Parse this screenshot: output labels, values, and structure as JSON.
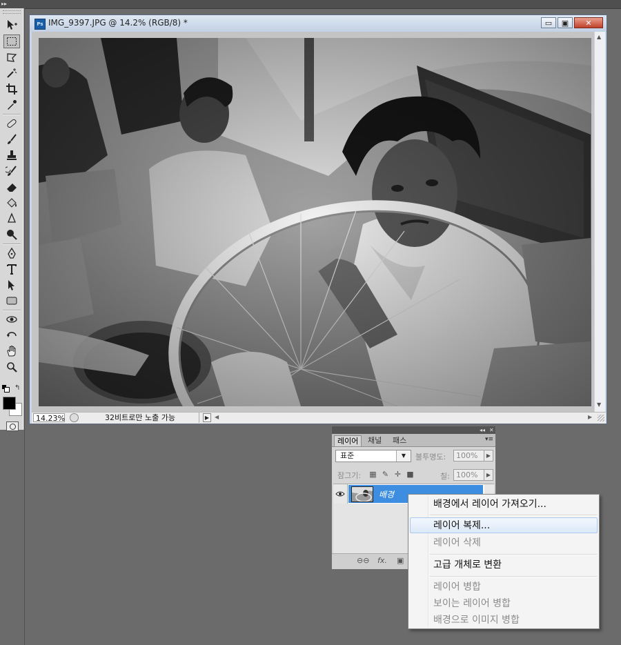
{
  "document": {
    "title": "IMG_9397.JPG @ 14.2% (RGB/8) *",
    "app_badge": "Ps",
    "zoom": "14.23%",
    "status_text": "32비트로만 노출 가능"
  },
  "window_controls": {
    "minimize_glyph": "▭",
    "maximize_glyph": "▣",
    "close_glyph": "✕"
  },
  "tools": [
    {
      "name": "move-tool-icon"
    },
    {
      "name": "marquee-tool-icon",
      "active": true
    },
    {
      "name": "lasso-tool-icon"
    },
    {
      "name": "magic-wand-tool-icon"
    },
    {
      "name": "crop-tool-icon"
    },
    {
      "name": "eyedropper-tool-icon"
    },
    {
      "name": "healing-brush-tool-icon"
    },
    {
      "name": "brush-tool-icon"
    },
    {
      "name": "clone-stamp-tool-icon"
    },
    {
      "name": "history-brush-tool-icon"
    },
    {
      "name": "eraser-tool-icon"
    },
    {
      "name": "paint-bucket-tool-icon"
    },
    {
      "name": "blur-tool-icon"
    },
    {
      "name": "dodge-tool-icon"
    },
    {
      "name": "pen-tool-icon"
    },
    {
      "name": "type-tool-icon"
    },
    {
      "name": "path-selection-tool-icon"
    },
    {
      "name": "rectangle-shape-tool-icon"
    },
    {
      "name": "3d-rotate-tool-icon"
    },
    {
      "name": "3d-orbit-tool-icon"
    },
    {
      "name": "hand-tool-icon"
    },
    {
      "name": "zoom-tool-icon"
    }
  ],
  "colors": {
    "foreground": "#000000",
    "background": "#ffffff",
    "selection_accent": "#3d8ee0",
    "close_button": "#c0412a"
  },
  "layers_panel": {
    "tabs": [
      {
        "label": "레이어",
        "active": true
      },
      {
        "label": "채널",
        "active": false
      },
      {
        "label": "패스",
        "active": false
      }
    ],
    "blend_mode": "표준",
    "opacity_label": "불투명도:",
    "opacity_value": "100%",
    "lock_label": "잠그기:",
    "fill_label": "칠:",
    "fill_value": "100%",
    "layers": [
      {
        "name": "배경",
        "visible": true,
        "selected": true
      }
    ],
    "bottom_icons": [
      "link-icon",
      "fx-icon",
      "mask-icon"
    ]
  },
  "context_menu": {
    "items": [
      {
        "label": "배경에서 레이어 가져오기...",
        "enabled": true
      },
      {
        "label": "레이어 복제...",
        "enabled": true,
        "highlighted": true
      },
      {
        "label": "레이어 삭제",
        "enabled": false
      },
      {
        "label": "고급 개체로 변환",
        "enabled": true
      },
      {
        "label": "레이어 병합",
        "enabled": false
      },
      {
        "label": "보이는 레이어 병합",
        "enabled": false
      },
      {
        "label": "배경으로 이미지 병합",
        "enabled": false
      }
    ]
  }
}
